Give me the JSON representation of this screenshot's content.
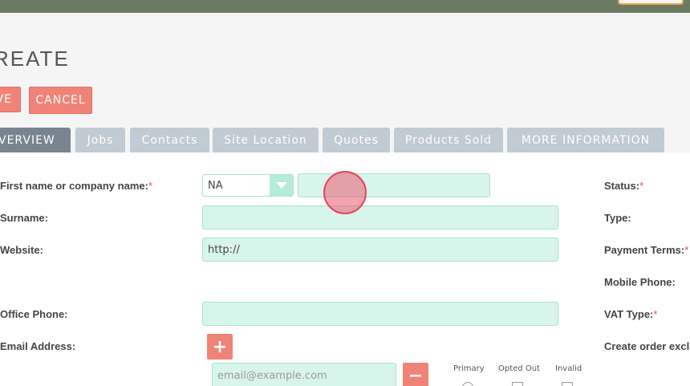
{
  "header": {
    "title": "REATE"
  },
  "actions": {
    "save_label": "VE",
    "cancel_label": "CANCEL"
  },
  "tabs": [
    {
      "label": "VERVIEW"
    },
    {
      "label": "Jobs"
    },
    {
      "label": "Contacts"
    },
    {
      "label": "Site Location"
    },
    {
      "label": "Quotes"
    },
    {
      "label": "Products Sold"
    },
    {
      "label": "MORE INFORMATION"
    }
  ],
  "form": {
    "first_name_label": "First name or company name:",
    "salutation_value": "NA",
    "first_name_value": "",
    "surname_label": "Surname:",
    "surname_value": "",
    "website_label": "Website:",
    "website_value": "http://",
    "office_phone_label": "Office Phone:",
    "office_phone_value": "",
    "email_label": "Email Address:",
    "email_placeholder": "email@example.com",
    "email_col_primary": "Primary",
    "email_col_opted_out": "Opted Out",
    "email_col_invalid": "Invalid",
    "required_mark": "*"
  },
  "right_labels": {
    "status": "Status:",
    "type": "Type:",
    "payment_terms": "Payment Terms:",
    "mobile_phone": "Mobile Phone:",
    "vat_type": "VAT Type:",
    "create_order": "Create order excl"
  },
  "colors": {
    "accent_button": "#f08377",
    "field_bg": "#d8f5ec",
    "tab_inactive": "#c0cbd3",
    "tab_active": "#78858f",
    "topbar": "#6a7b62"
  }
}
